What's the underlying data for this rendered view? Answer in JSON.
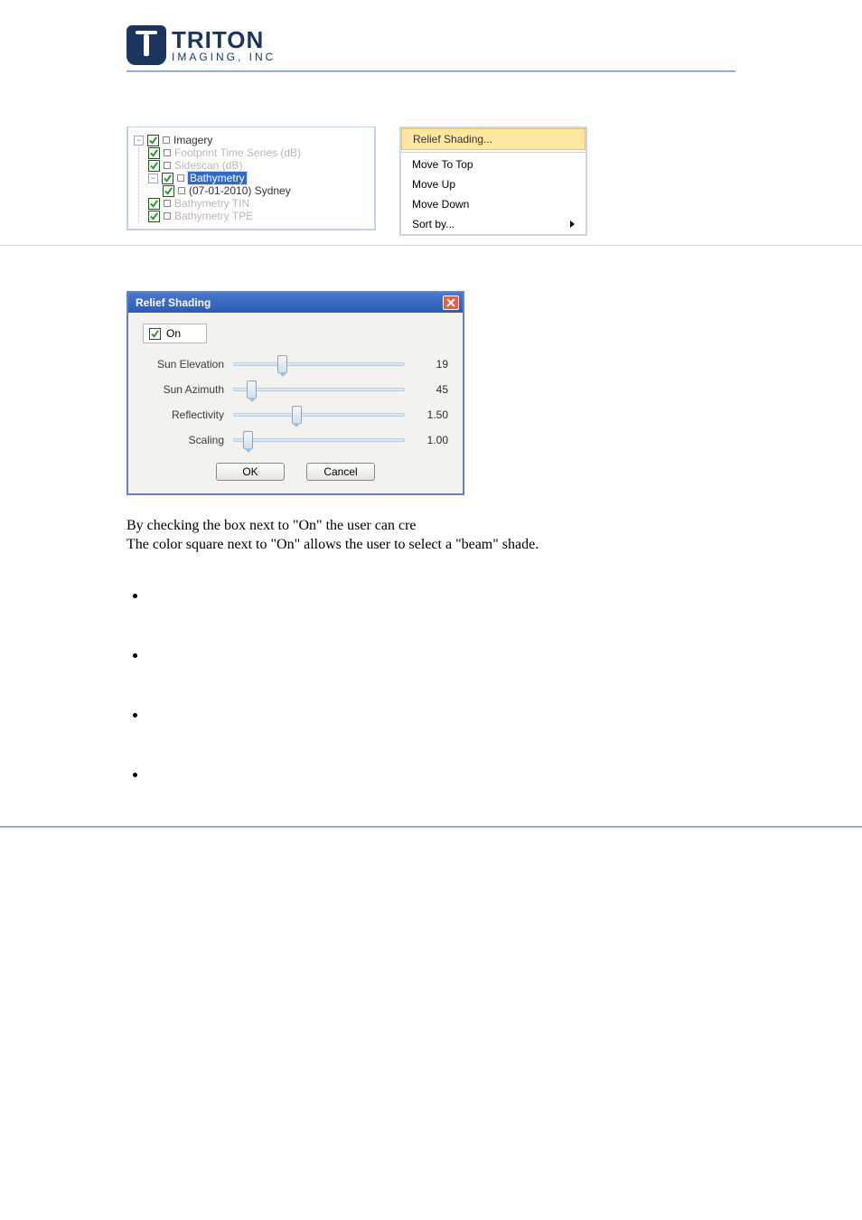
{
  "logo": {
    "word": "TRITON",
    "sub": "IMAGING, INC"
  },
  "tree": {
    "imagery": {
      "label": "Imagery",
      "expander": "−"
    },
    "footprint": {
      "label": "Footprint Time Series (dB)"
    },
    "sidescan": {
      "label": "Sidescan (dB)"
    },
    "bathymetry": {
      "label": "Bathymetry",
      "expander": "−"
    },
    "sydney": {
      "label": "(07-01-2010) Sydney"
    },
    "tin": {
      "label": "Bathymetry TIN"
    },
    "tpe": {
      "label": "Bathymetry TPE"
    }
  },
  "menu": {
    "relief": "Relief Shading...",
    "movetop": "Move To Top",
    "moveup": "Move Up",
    "movedown": "Move Down",
    "sortby": "Sort by..."
  },
  "dialog": {
    "title": "Relief Shading",
    "on_label": "On",
    "rows": {
      "elev": {
        "label": "Sun Elevation",
        "value": "19"
      },
      "azim": {
        "label": "Sun Azimuth",
        "value": "45"
      },
      "refl": {
        "label": "Reflectivity",
        "value": "1.50"
      },
      "scal": {
        "label": "Scaling",
        "value": "1.00"
      }
    },
    "ok": "OK",
    "cancel": "Cancel"
  },
  "text": {
    "line1": "By checking the box next to \"On\" the user can cre",
    "line2": "The color square next to \"On\" allows the user to select a \"beam\" shade."
  },
  "bullets": [
    "",
    "",
    "",
    ""
  ]
}
